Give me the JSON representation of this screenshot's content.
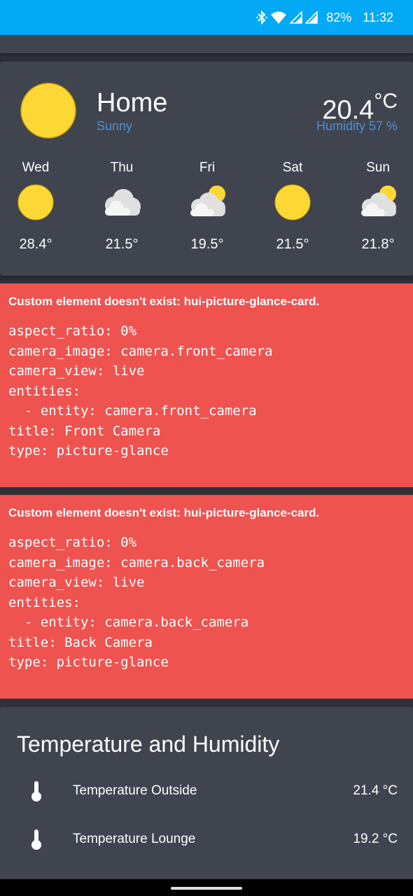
{
  "status_bar": {
    "battery": "82%",
    "time": "11:32",
    "icons": [
      "bluetooth-icon",
      "wifi-icon",
      "signal-icon",
      "signal-icon"
    ]
  },
  "weather": {
    "title": "Home",
    "condition": "Sunny",
    "temperature": "20.4",
    "unit": "°C",
    "humidity": "Humidity 57 %",
    "condition_color": "#4a90d9",
    "forecast": [
      {
        "day": "Wed",
        "icon": "sunny-icon",
        "temp": "28.4°"
      },
      {
        "day": "Thu",
        "icon": "cloudy-icon",
        "temp": "21.5°"
      },
      {
        "day": "Fri",
        "icon": "partly-cloudy-icon",
        "temp": "19.5°"
      },
      {
        "day": "Sat",
        "icon": "sunny-icon",
        "temp": "21.5°"
      },
      {
        "day": "Sun",
        "icon": "partly-cloudy-icon",
        "temp": "21.8°"
      }
    ]
  },
  "error_cards": [
    {
      "title": "Custom element doesn't exist: hui-picture-glance-card.",
      "lines": [
        "aspect_ratio: 0%",
        "camera_image: camera.front_camera",
        "camera_view: live",
        "entities:",
        "  - entity: camera.front_camera",
        "title: Front Camera",
        "type: picture-glance"
      ]
    },
    {
      "title": "Custom element doesn't exist: hui-picture-glance-card.",
      "lines": [
        "aspect_ratio: 0%",
        "camera_image: camera.back_camera",
        "camera_view: live",
        "entities:",
        "  - entity: camera.back_camera",
        "title: Back Camera",
        "type: picture-glance"
      ]
    }
  ],
  "temp_card": {
    "title": "Temperature and Humidity",
    "entities": [
      {
        "icon": "thermometer-icon",
        "name": "Temperature Outside",
        "value": "21.4 °C"
      },
      {
        "icon": "thermometer-icon",
        "name": "Temperature Lounge",
        "value": "19.2 °C"
      }
    ]
  },
  "colors": {
    "accent": "#03a9f4",
    "card_bg": "#40444e",
    "page_bg": "#2d3038",
    "error_bg": "#ef5350",
    "sun": "#fdd835"
  }
}
